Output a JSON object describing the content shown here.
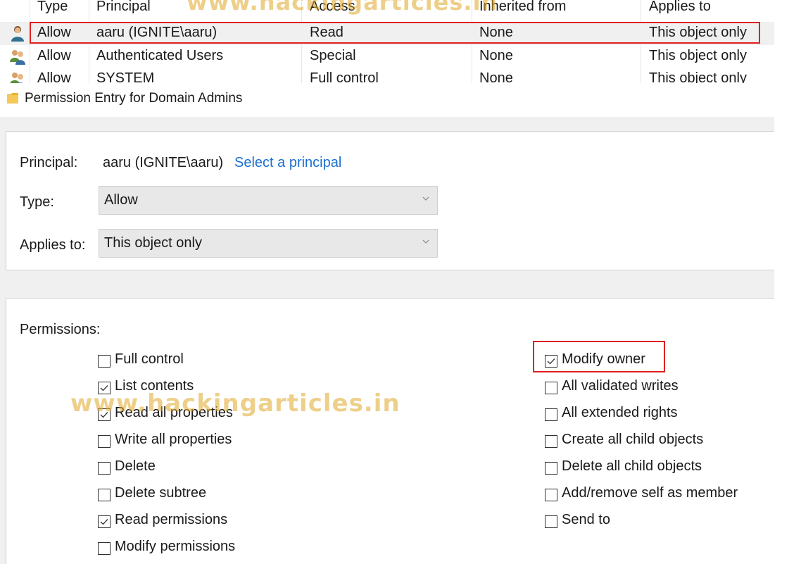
{
  "acl_table": {
    "headers": [
      "Type",
      "Principal",
      "Access",
      "Inherited from",
      "Applies to"
    ],
    "rows": [
      {
        "icon": "user-icon",
        "type": "Allow",
        "principal": "aaru (IGNITE\\aaru)",
        "access": "Read",
        "inherited_from": "None",
        "applies_to": "This object only"
      },
      {
        "icon": "users-group-icon",
        "type": "Allow",
        "principal": "Authenticated Users",
        "access": "Special",
        "inherited_from": "None",
        "applies_to": "This object only"
      },
      {
        "icon": "users-group-icon",
        "type": "Allow",
        "principal": "SYSTEM",
        "access": "Full control",
        "inherited_from": "None",
        "applies_to": "This object only"
      }
    ]
  },
  "dialog": {
    "title": "Permission Entry for Domain Admins",
    "title_icon": "folder-icon",
    "principal_label": "Principal:",
    "principal_value": "aaru (IGNITE\\aaru)",
    "select_principal_link": "Select a principal",
    "type_label": "Type:",
    "type_value": "Allow",
    "applies_label": "Applies to:",
    "applies_value": "This object only",
    "permissions_label": "Permissions:"
  },
  "permissions_left": [
    {
      "label": "Full control",
      "checked": false
    },
    {
      "label": "List contents",
      "checked": true
    },
    {
      "label": "Read all properties",
      "checked": true
    },
    {
      "label": "Write all properties",
      "checked": false
    },
    {
      "label": "Delete",
      "checked": false
    },
    {
      "label": "Delete subtree",
      "checked": false
    },
    {
      "label": "Read permissions",
      "checked": true
    },
    {
      "label": "Modify permissions",
      "checked": false
    }
  ],
  "permissions_right": [
    {
      "label": "Modify owner",
      "checked": true
    },
    {
      "label": "All validated writes",
      "checked": false
    },
    {
      "label": "All extended rights",
      "checked": false
    },
    {
      "label": "Create all child objects",
      "checked": false
    },
    {
      "label": "Delete all child objects",
      "checked": false
    },
    {
      "label": "Add/remove self as member",
      "checked": false
    },
    {
      "label": "Send to",
      "checked": false
    }
  ],
  "watermark": "www.hackingarticles.in",
  "colors": {
    "highlight": "#e02020",
    "link": "#1a6fcf",
    "watermark": "#e0a828",
    "selected_row": "#f0f0f0"
  }
}
